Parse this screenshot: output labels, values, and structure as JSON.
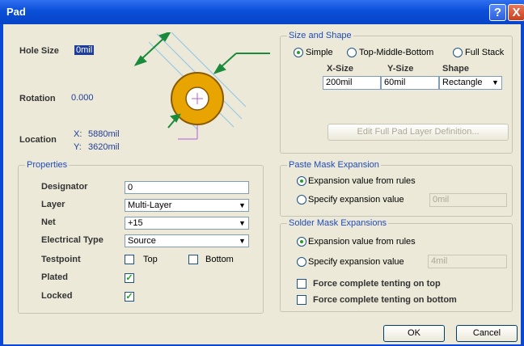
{
  "window": {
    "title": "Pad",
    "help": "?",
    "close": "X"
  },
  "hole": {
    "label": "Hole Size",
    "value": "0mil"
  },
  "rotation": {
    "label": "Rotation",
    "value": "0.000"
  },
  "location": {
    "label": "Location",
    "x_label": "X:",
    "x_value": "5880mil",
    "y_label": "Y:",
    "y_value": "3620mil"
  },
  "size_shape": {
    "title": "Size and Shape",
    "options": [
      "Simple",
      "Top-Middle-Bottom",
      "Full Stack"
    ],
    "selected": "Simple",
    "col_xsize": "X-Size",
    "col_ysize": "Y-Size",
    "col_shape": "Shape",
    "xsize": "200mil",
    "ysize": "60mil",
    "shape": "Rectangle",
    "edit_button": "Edit Full Pad Layer Definition..."
  },
  "properties": {
    "title": "Properties",
    "designator_label": "Designator",
    "designator": "0",
    "layer_label": "Layer",
    "layer": "Multi-Layer",
    "net_label": "Net",
    "net": "+15",
    "etype_label": "Electrical Type",
    "etype": "Source",
    "testpoint_label": "Testpoint",
    "tp_top": "Top",
    "tp_bottom": "Bottom",
    "tp_top_checked": false,
    "tp_bottom_checked": false,
    "plated_label": "Plated",
    "plated_checked": true,
    "locked_label": "Locked",
    "locked_checked": true
  },
  "paste_mask": {
    "title": "Paste Mask Expansion",
    "opt_rules": "Expansion value from rules",
    "opt_specify": "Specify expansion value",
    "selected": "rules",
    "value": "0mil"
  },
  "solder_mask": {
    "title": "Solder Mask Expansions",
    "opt_rules": "Expansion value from rules",
    "opt_specify": "Specify expansion value",
    "selected": "rules",
    "value": "4mil",
    "tent_top": "Force complete tenting on top",
    "tent_bottom": "Force complete tenting on bottom",
    "tent_top_checked": false,
    "tent_bottom_checked": false
  },
  "buttons": {
    "ok": "OK",
    "cancel": "Cancel"
  },
  "colors": {
    "pad_ring": "#e8a400",
    "arrows": "#1b8a3a",
    "accent": "#1e4bbf",
    "titlebar": "#0b4fd8"
  }
}
